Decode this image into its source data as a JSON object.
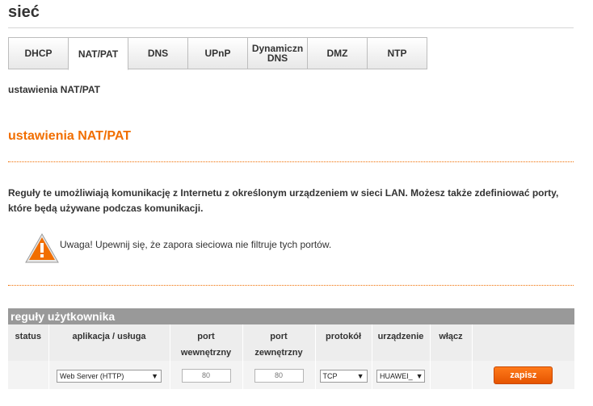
{
  "page": {
    "title": "sieć",
    "breadcrumb": "ustawienia NAT/PAT"
  },
  "tabs": [
    {
      "label": "DHCP",
      "active": false
    },
    {
      "label": "NAT/PAT",
      "active": true
    },
    {
      "label": "DNS",
      "active": false
    },
    {
      "label": "UPnP",
      "active": false
    },
    {
      "label": "Dynamiczn DNS",
      "active": false
    },
    {
      "label": "DMZ",
      "active": false
    },
    {
      "label": "NTP",
      "active": false
    }
  ],
  "section": {
    "title": "ustawienia NAT/PAT",
    "description": "Reguły te umożliwiają komunikację z Internetu z określonym urządzeniem w sieci LAN. Możesz także zdefiniować porty, które będą używane podczas komunikacji.",
    "warning": "Uwaga! Upewnij się, że zapora sieciowa nie filtruje tych portów."
  },
  "rules_table": {
    "title": "reguły użytkownika",
    "columns": {
      "status": "status",
      "service": "aplikacja / usługa",
      "internal_port": "port wewnętrzny",
      "external_port": "port zewnętrzny",
      "protocol": "protokół",
      "device": "urządzenie",
      "enable": "włącz"
    },
    "new_rule": {
      "service": "Web Server (HTTP)",
      "internal_port": "80",
      "external_port": "80",
      "protocol": "TCP",
      "device": "HUAWEI_",
      "save_label": "zapisz"
    }
  },
  "colors": {
    "accent": "#f16e00",
    "table_header": "#999999",
    "button": "#ff6a00"
  },
  "icons": {
    "warning": "warning-triangle-icon",
    "dropdown": "chevron-down-icon"
  }
}
